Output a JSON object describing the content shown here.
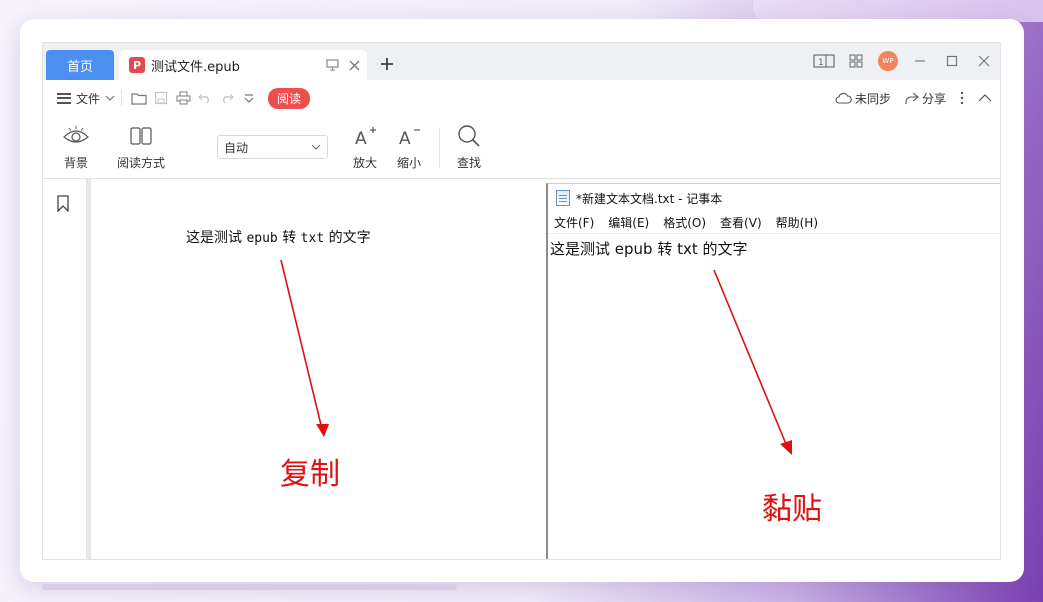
{
  "tabs": {
    "home_label": "首页",
    "doc_label": "测试文件.epub",
    "doc_icon_glyph": "P"
  },
  "window_controls": {
    "avatar_text": "WP"
  },
  "menubar": {
    "file_label": "文件",
    "read_badge": "阅读",
    "unsync_label": "未同步",
    "share_label": "分享"
  },
  "ribbon": {
    "background_label": "背景",
    "reading_mode_label": "阅读方式",
    "zoom_select_value": "自动",
    "zoom_in_label": "放大",
    "zoom_out_label": "缩小",
    "find_label": "查找"
  },
  "document": {
    "text_part1": "这是测试",
    "text_mono1": "epub",
    "text_part2": "转",
    "text_mono2": "txt",
    "text_part3": "的文字"
  },
  "notepad": {
    "title": "*新建文本文档.txt - 记事本",
    "menu": [
      "文件(F)",
      "编辑(E)",
      "格式(O)",
      "查看(V)",
      "帮助(H)"
    ],
    "content": "这是测试 epub 转 txt 的文字"
  },
  "annotations": {
    "copy_label": "复制",
    "paste_label": "黏贴",
    "color": "#e01010"
  },
  "colors": {
    "accent_tab": "#4b8ff0",
    "read_badge": "#ee4e4e"
  }
}
